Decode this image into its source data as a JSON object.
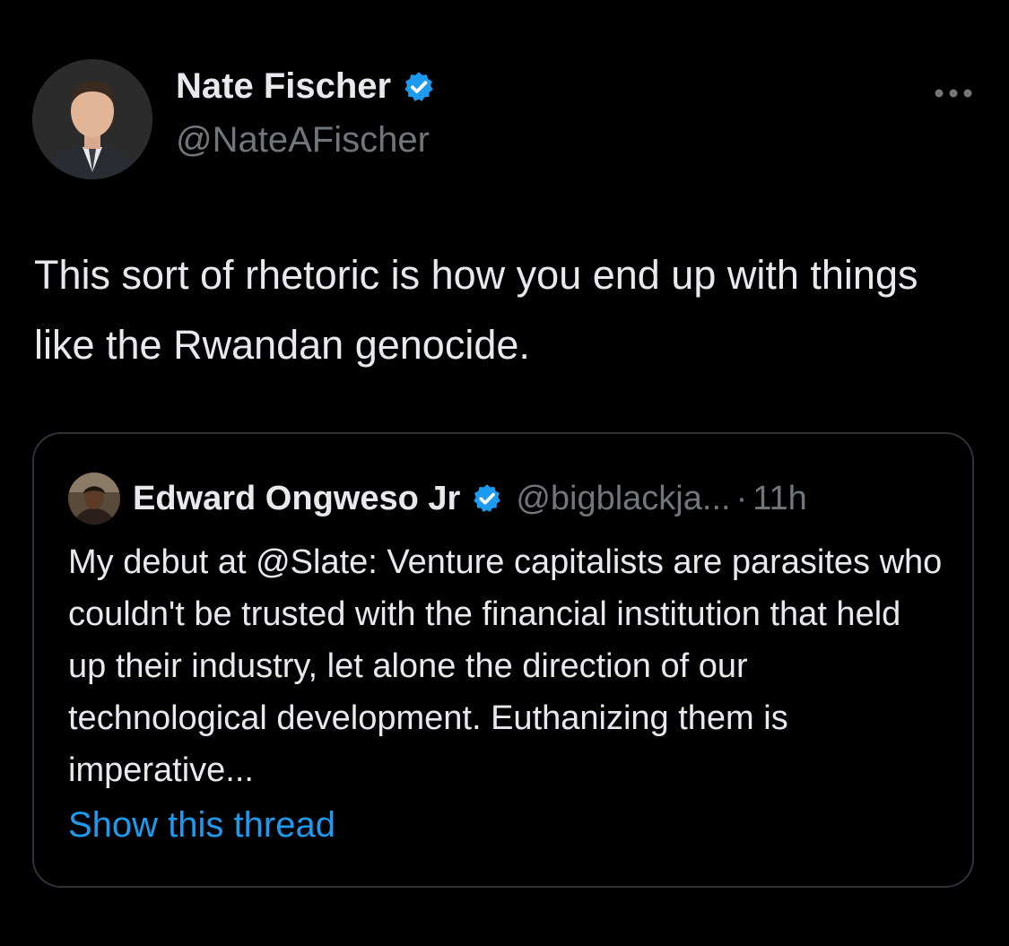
{
  "tweet": {
    "author": {
      "name": "Nate Fischer",
      "handle": "@NateAFischer",
      "verified": true,
      "avatar_icon": "avatar-photo-icon"
    },
    "more_icon": "more-horizontal-icon",
    "text": "This sort of rhetoric is how you end up with things like the Rwandan genocide."
  },
  "quote": {
    "author": {
      "name": "Edward Ongweso Jr",
      "handle": "@bigblackja...",
      "verified": true,
      "avatar_icon": "avatar-photo-icon"
    },
    "separator": "·",
    "time": "11h",
    "text": "My debut at @Slate: Venture capitalists are parasites who couldn't be trusted with the financial institution that held up their industry, let alone the direction of our technological development. Euthanizing them is imperative...",
    "show_thread_label": "Show this thread"
  },
  "colors": {
    "background": "#000000",
    "text_primary": "#e7e9ea",
    "text_secondary": "#71767b",
    "accent": "#1d9bf0",
    "border": "#2f3336"
  }
}
